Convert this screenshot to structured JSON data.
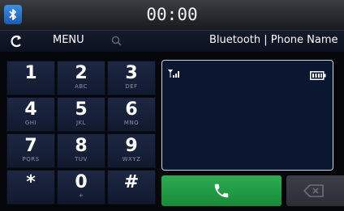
{
  "status_bar": {
    "time": "00:00",
    "bluetooth_icon": "bluetooth-icon"
  },
  "menu_bar": {
    "back_icon": "back-arrow-icon",
    "menu_label": "MENU",
    "search_icon": "search-icon",
    "title": "Bluetooth | Phone Name"
  },
  "keypad": {
    "keys": [
      {
        "digit": "1",
        "letters": ""
      },
      {
        "digit": "2",
        "letters": "ABC"
      },
      {
        "digit": "3",
        "letters": "DEF"
      },
      {
        "digit": "4",
        "letters": "GHI"
      },
      {
        "digit": "5",
        "letters": "JKL"
      },
      {
        "digit": "6",
        "letters": "MNO"
      },
      {
        "digit": "7",
        "letters": "PQRS"
      },
      {
        "digit": "8",
        "letters": "TUV"
      },
      {
        "digit": "9",
        "letters": "WXYZ"
      },
      {
        "digit": "*",
        "letters": ""
      },
      {
        "digit": "0",
        "letters": "+"
      },
      {
        "digit": "#",
        "letters": ""
      }
    ]
  },
  "display": {
    "signal_icon": "signal-strength-icon",
    "battery_icon": "battery-icon"
  },
  "actions": {
    "call_icon": "phone-handset-icon",
    "backspace_icon": "backspace-icon",
    "call_color": "#23a046"
  }
}
